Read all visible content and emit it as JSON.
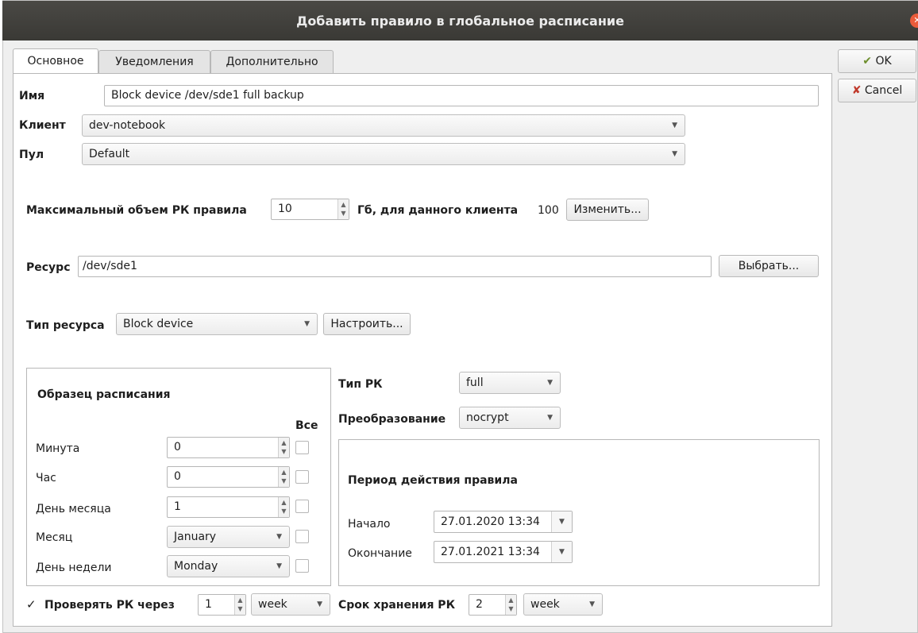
{
  "window": {
    "title": "Добавить правило в глобальное расписание"
  },
  "tabs": [
    {
      "label": "Основное",
      "active": true
    },
    {
      "label": "Уведомления",
      "active": false
    },
    {
      "label": "Дополнительно",
      "active": false
    }
  ],
  "side_buttons": {
    "ok": "OK",
    "cancel": "Cancel"
  },
  "form": {
    "name_label": "Имя",
    "name_value": "Block device /dev/sde1 full backup",
    "client_label": "Клиент",
    "client_value": "dev-notebook",
    "pool_label": "Пул",
    "pool_value": "Default",
    "max_label": "Максимальный объем РК правила",
    "max_value": "10",
    "max_unit": "Гб, для данного клиента",
    "max_client_value": "100",
    "change_button": "Изменить...",
    "resource_label": "Ресурс",
    "resource_value": "/dev/sde1",
    "choose_button": "Выбрать...",
    "resource_type_label": "Тип ресурса",
    "resource_type_value": "Block device",
    "configure_button": "Настроить..."
  },
  "schedule": {
    "title": "Образец расписания",
    "all_label": "Все",
    "minute_label": "Минута",
    "minute_value": "0",
    "hour_label": "Час",
    "hour_value": "0",
    "day_label": "День месяца",
    "day_value": "1",
    "month_label": "Месяц",
    "month_value": "January",
    "weekday_label": "День недели",
    "weekday_value": "Monday"
  },
  "backup": {
    "type_label": "Тип РК",
    "type_value": "full",
    "transform_label": "Преобразование",
    "transform_value": "nocrypt"
  },
  "period": {
    "title": "Период действия правила",
    "start_label": "Начало",
    "start_value": "27.01.2020 13:34",
    "end_label": "Окончание",
    "end_value": "27.01.2021 13:34"
  },
  "footer": {
    "check_label": "Проверять РК через",
    "check_checked": true,
    "check_value": "1",
    "check_unit": "week",
    "retention_label": "Срок хранения РК",
    "retention_value": "2",
    "retention_unit": "week"
  },
  "colors": {
    "titlebar": "#3d3c38",
    "close": "#ea5b3b",
    "ok_icon": "#6e8f2e",
    "cancel_icon": "#c0392b"
  }
}
